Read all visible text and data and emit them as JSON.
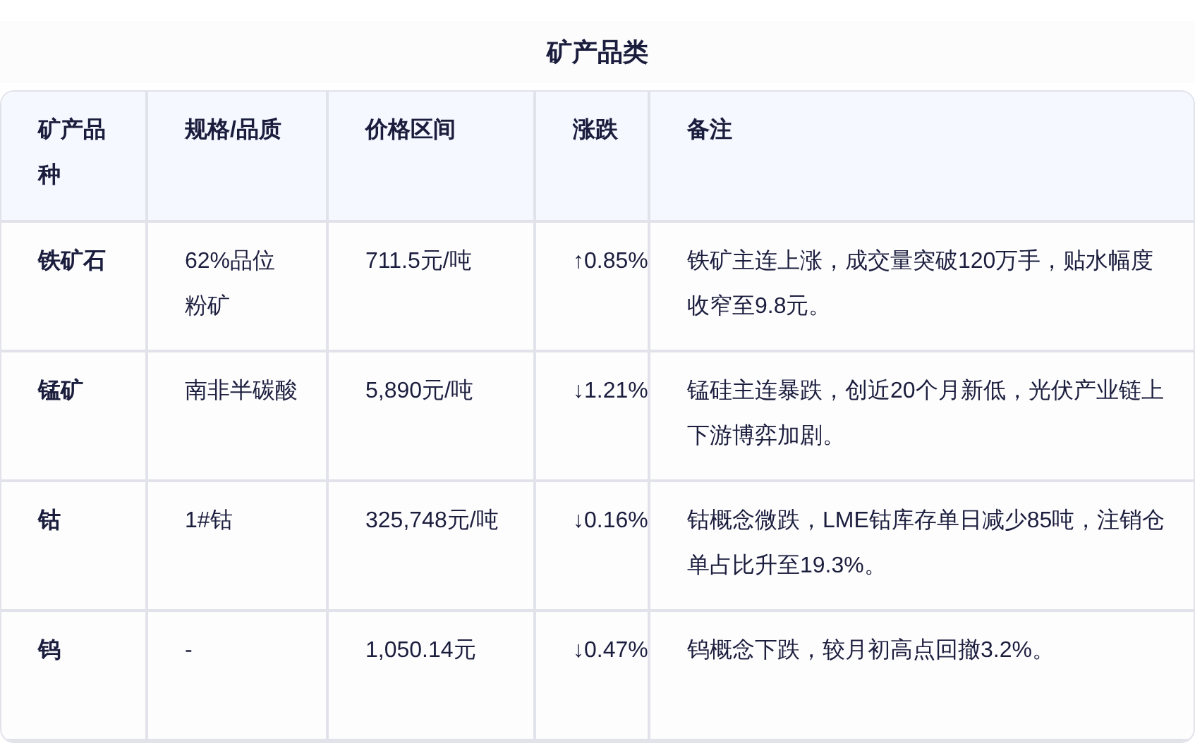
{
  "title": "矿产品类",
  "table": {
    "columns": [
      "矿产品种",
      "规格/品质",
      "价格区间",
      "涨跌",
      "备注"
    ],
    "rows": [
      {
        "cells": [
          "铁矿石",
          "62%品位粉矿",
          "711.5元/吨",
          "↑0.85%",
          "铁矿主连上涨，成交量突破120万手，贴水幅度收窄至9.8元。"
        ]
      },
      {
        "cells": [
          "锰矿",
          "南非半碳酸",
          "5,890元/吨",
          "↓1.21%",
          "锰硅主连暴跌，创近20个月新低，光伏产业链上下游博弈加剧。"
        ]
      },
      {
        "cells": [
          "钴",
          "1#钴",
          "325,748元/吨",
          "↓0.16%",
          "钴概念微跌，LME钴库存单日减少85吨，注销仓单占比升至19.3%。"
        ]
      },
      {
        "cells": [
          "钨",
          "-",
          "1,050.14元",
          "↓0.47%",
          "钨概念下跌，较月初高点回撤3.2%。"
        ]
      }
    ]
  }
}
